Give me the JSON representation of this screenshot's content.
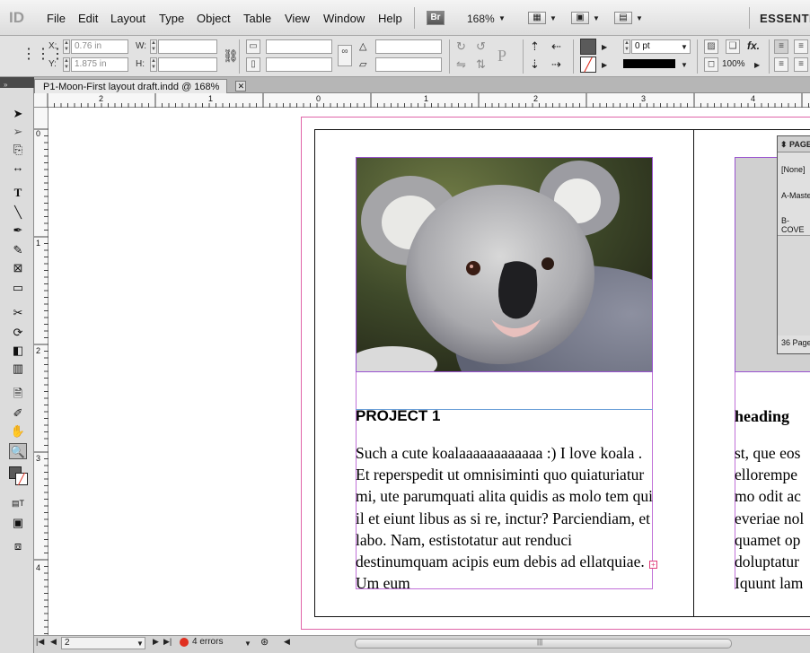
{
  "app": {
    "logo": "ID",
    "workspace": "ESSENTIA"
  },
  "menu": [
    "File",
    "Edit",
    "Layout",
    "Type",
    "Object",
    "Table",
    "View",
    "Window",
    "Help"
  ],
  "appbar": {
    "bridge": "Br",
    "zoom": "168%"
  },
  "control": {
    "x_label": "X:",
    "x_value": "0.76 in",
    "y_label": "Y:",
    "y_value": "1.875 in",
    "w_label": "W:",
    "h_label": "H:",
    "stroke": "0 pt",
    "scale": "100%"
  },
  "document": {
    "tab_title": "P1-Moon-First layout draft.indd @ 168%"
  },
  "ruler": {
    "h_ticks": [
      "2",
      "1",
      "0",
      "1",
      "2",
      "3",
      "4"
    ],
    "v_ticks": [
      "0",
      "1",
      "2",
      "3",
      "4"
    ]
  },
  "page": {
    "heading": "PROJECT 1",
    "body": "Such a cute koalaaaaaaaaaaaa :) I love koala . Et reperspedit ut omnisiminti quo quiaturiatur mi, ute parumquati alita quidis as molo tem qui il et eiunt libus as si re, inctur? Parciendiam, et labo. Nam, estistotatur aut renduci destinumquam acipis eum debis ad ellatquiae. Um eum"
  },
  "right_page": {
    "heading": "heading",
    "lines": [
      "st, que eos",
      "ellorempe",
      "mo odit ac",
      "everiae nol",
      "quamet op",
      "doluptatur",
      "Iquunt lam"
    ]
  },
  "pages_panel": {
    "title": "PAGE",
    "items": [
      "[None]",
      "A-Maste",
      "B-COVE"
    ],
    "footer": "36 Page"
  },
  "status": {
    "page": "2",
    "errors": "4 errors"
  },
  "colors": {
    "bleed": "#e064a8",
    "frame": "#9a52d0",
    "guide": "#6a9fd8",
    "error": "#e03020"
  }
}
